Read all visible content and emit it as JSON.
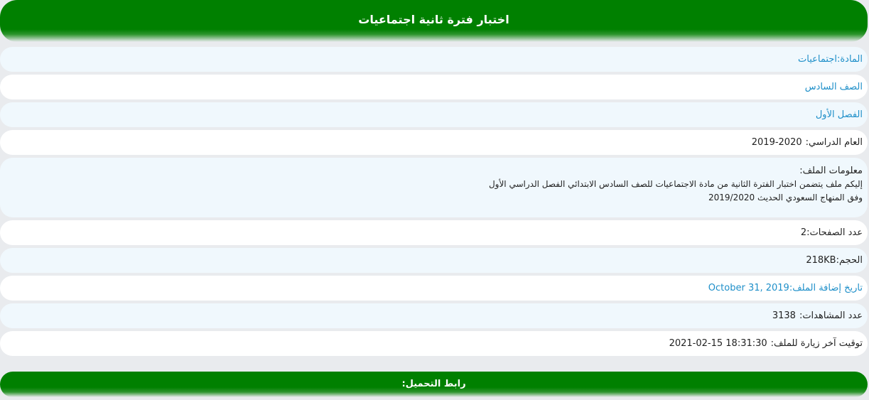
{
  "header": {
    "title": "اختبار فترة ثانية اجتماعيات"
  },
  "rows": {
    "subject": "المادة:اجتماعيات",
    "grade": "الصف السادس",
    "semester": "الفصل الأول",
    "year_label": "العام الدراسي:",
    "year_value": "2019-2020",
    "file_info_label": "معلومات الملف:",
    "file_info_line1": "إليكم ملف يتضمن اختبار الفترة الثانية من مادة الاجتماعيات للصف السادس الابتدائي الفصل الدراسي الأول",
    "file_info_line2": "وفق المنهاج السعودي الحديث 2019/2020",
    "pages_label": "عدد الصفحات:",
    "pages_value": "2",
    "size_label": "الحجم:",
    "size_value": "218KB",
    "date_added_label": "تاريخ إضافة الملف:",
    "date_added_value": "October 31, 2019",
    "views_label": "عدد المشاهدات:",
    "views_value": "3138",
    "last_visit_label": "توقيت آخر زيارة للملف:",
    "last_visit_value": "2021-02-15 18:31:30"
  },
  "footer": {
    "download_label": "رابط التحميل:"
  },
  "colors": {
    "brand_green": "#008000",
    "link_blue": "#1e8fc9",
    "row_alt": "#f0f8fd",
    "background": "#e9ebee"
  }
}
